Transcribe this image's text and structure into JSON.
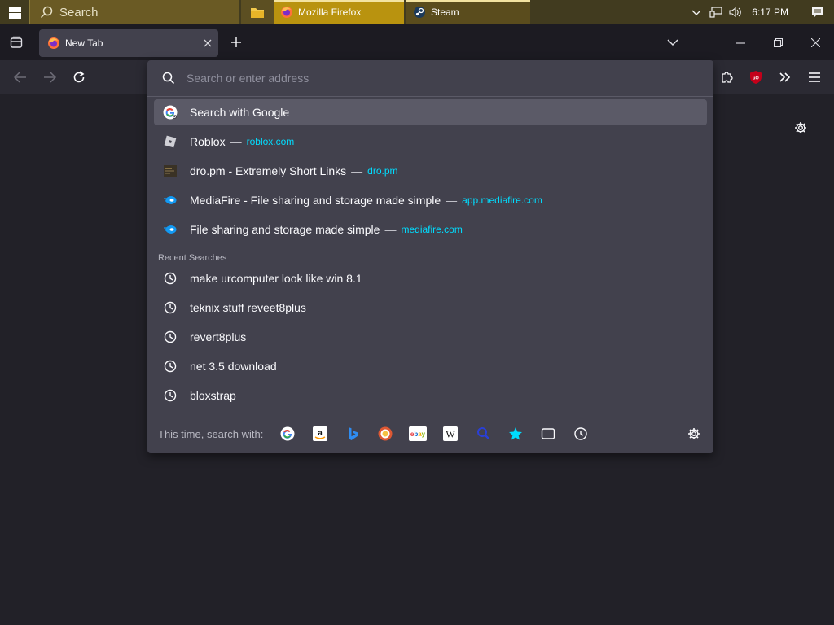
{
  "taskbar": {
    "search_label": "Search",
    "apps": [
      {
        "label": "Mozilla Firefox"
      },
      {
        "label": "Steam"
      }
    ],
    "clock": "6:17 PM"
  },
  "tabs": [
    {
      "title": "New Tab"
    }
  ],
  "urlbar": {
    "placeholder": "Search or enter address",
    "heuristic": {
      "label": "Search with Google"
    },
    "suggestions": [
      {
        "title": "Roblox",
        "url": "roblox.com"
      },
      {
        "title": "dro.pm - Extremely Short Links",
        "url": "dro.pm"
      },
      {
        "title": "MediaFire - File sharing and storage made simple",
        "url": "app.mediafire.com"
      },
      {
        "title": "File sharing and storage made simple",
        "url": "mediafire.com"
      }
    ],
    "separator": "—",
    "recent_heading": "Recent Searches",
    "recent": [
      {
        "label": "make urcomputer look like win 8.1"
      },
      {
        "label": "teknix stuff reveet8plus"
      },
      {
        "label": "revert8plus"
      },
      {
        "label": "net 3.5 download"
      },
      {
        "label": "bloxstrap"
      }
    ],
    "oneoff_label": "This time, search with:",
    "engines": [
      "google-icon",
      "amazon-icon",
      "bing-icon",
      "duckduckgo-icon",
      "ebay-icon",
      "wikipedia-icon",
      "search-history-icon",
      "bookmarks-icon",
      "tabs-icon",
      "history-icon"
    ]
  },
  "colors": {
    "taskbar": "#413b1f",
    "accent_link": "#00ddff",
    "panel": "#42414d",
    "selected_row": "#5b5a67"
  }
}
